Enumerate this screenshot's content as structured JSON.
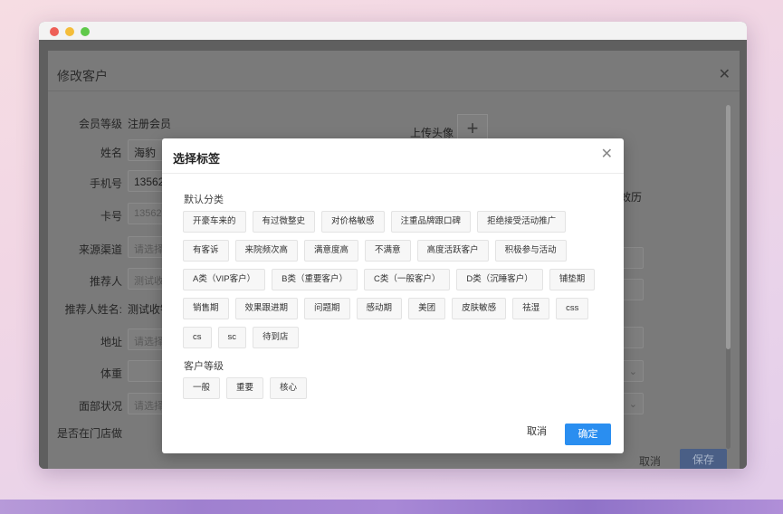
{
  "window": {
    "bg_dialog": {
      "title": "修改客户",
      "fields": {
        "level_label": "会员等级",
        "level_value": "注册会员",
        "name_label": "姓名",
        "name_value": "海豹",
        "phone_label": "手机号",
        "phone_value": "13562",
        "card_label": "卡号",
        "card_placeholder": "13562",
        "source_label": "来源渠道",
        "source_placeholder": "请选择",
        "referrer_label": "推荐人",
        "referrer_placeholder": "测试收",
        "referrer_name_label": "推荐人姓名:",
        "referrer_name_value": "测试收银",
        "address_label": "地址",
        "address_placeholder": "请选择",
        "weight_label": "体重",
        "face_label": "面部状况",
        "face_placeholder": "请选择",
        "visited_label": "是否在门店做",
        "upload_label": "上传头像",
        "history_partial": "效历"
      },
      "cancel_label": "取消",
      "save_label": "保存"
    },
    "modal": {
      "title": "选择标签",
      "default_section": "默认分类",
      "default_tags": [
        "开豪车来的",
        "有过微整史",
        "对价格敏感",
        "注重品牌跟口碑",
        "拒绝接受活动推广",
        "有客诉",
        "来院频次高",
        "满意度高",
        "不满意",
        "高度活跃客户",
        "积极参与活动",
        "A类（VIP客户）",
        "B类（重要客户）",
        "C类（一般客户）",
        "D类（沉睡客户）",
        "铺垫期",
        "销售期",
        "效果跟进期",
        "问题期",
        "感动期",
        "美团",
        "皮肤敏感",
        "祛湿",
        "css",
        "cs",
        "sc",
        "待到店"
      ],
      "level_section": "客户等级",
      "level_tags": [
        "一般",
        "重要",
        "核心"
      ],
      "cancel_label": "取消",
      "ok_label": "确定"
    }
  }
}
